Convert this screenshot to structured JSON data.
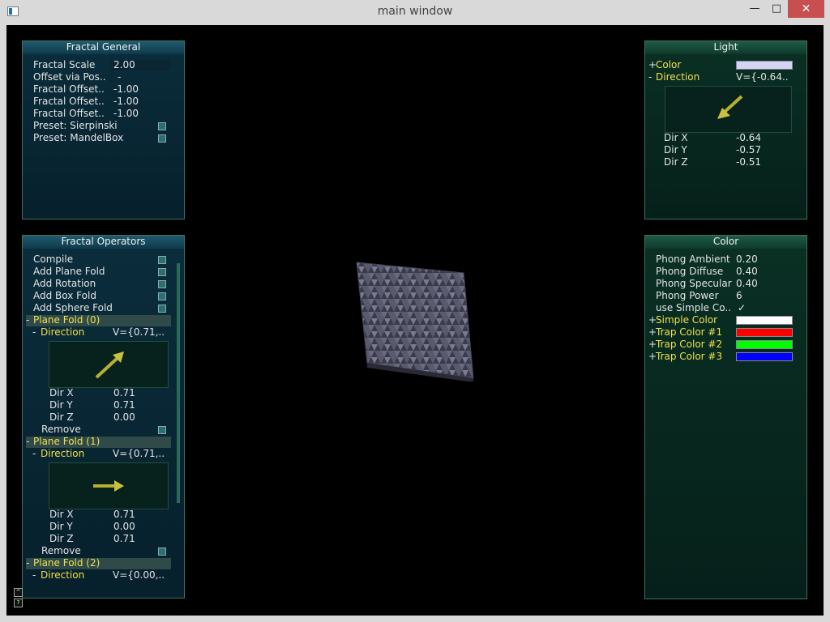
{
  "window": {
    "title": "main window",
    "min_icon": "minimize-icon",
    "max_icon": "maximize-icon",
    "close_icon": "close-icon"
  },
  "fractal_general": {
    "title": "Fractal General",
    "rows": [
      {
        "label": "Fractal Scale",
        "value": "2.00"
      },
      {
        "label": "Offset via Pos..",
        "value": "-"
      },
      {
        "label": "Fractal Offset..",
        "value": "-1.00"
      },
      {
        "label": "Fractal Offset..",
        "value": "-1.00"
      },
      {
        "label": "Fractal Offset..",
        "value": "-1.00"
      }
    ],
    "presets": [
      {
        "label": "Preset: Sierpinski"
      },
      {
        "label": "Preset: MandelBox"
      }
    ]
  },
  "fractal_operators": {
    "title": "Fractal Operators",
    "buttons": [
      {
        "label": "Compile"
      },
      {
        "label": "Add Plane Fold"
      },
      {
        "label": "Add Rotation"
      },
      {
        "label": "Add Box Fold"
      },
      {
        "label": "Add Sphere Fold"
      }
    ],
    "folds": [
      {
        "header": "Plane Fold (0)",
        "dir_label": "Direction",
        "dir_value": "V={0.71,..",
        "x": "0.71",
        "y": "0.71",
        "z": "0.00",
        "remove": "Remove"
      },
      {
        "header": "Plane Fold (1)",
        "dir_label": "Direction",
        "dir_value": "V={0.71,..",
        "x": "0.71",
        "y": "0.00",
        "z": "0.71",
        "remove": "Remove"
      },
      {
        "header": "Plane Fold (2)",
        "dir_label": "Direction",
        "dir_value": "V={0.00,.."
      }
    ],
    "dir_x_label": "Dir X",
    "dir_y_label": "Dir Y",
    "dir_z_label": "Dir Z",
    "expanded_mark": "-"
  },
  "light": {
    "title": "Light",
    "color_label": "Color",
    "color_swatch": "#d4d4f4",
    "direction_label": "Direction",
    "direction_value": "V={-0.64..",
    "dir_x_label": "Dir X",
    "dir_x": "-0.64",
    "dir_y_label": "Dir Y",
    "dir_y": "-0.57",
    "dir_z_label": "Dir Z",
    "dir_z": "-0.51",
    "collapsed_mark": "+",
    "expanded_mark": "-"
  },
  "color_panel": {
    "title": "Color",
    "rows": [
      {
        "label": "Phong Ambient",
        "value": "0.20"
      },
      {
        "label": "Phong Diffuse",
        "value": "0.40"
      },
      {
        "label": "Phong Specular",
        "value": "0.40"
      },
      {
        "label": "Phong Power",
        "value": "6"
      }
    ],
    "simple_label": "use Simple Co..",
    "simple_check": "✓",
    "swatches": [
      {
        "label": "Simple Color",
        "color": "#ffffff"
      },
      {
        "label": "Trap Color #1",
        "color": "#ff0000"
      },
      {
        "label": "Trap Color #2",
        "color": "#00ff00"
      },
      {
        "label": "Trap Color #3",
        "color": "#0000ff"
      }
    ],
    "collapsed_mark": "+"
  },
  "corner": {
    "up_glyph": "^",
    "help_glyph": "?"
  }
}
